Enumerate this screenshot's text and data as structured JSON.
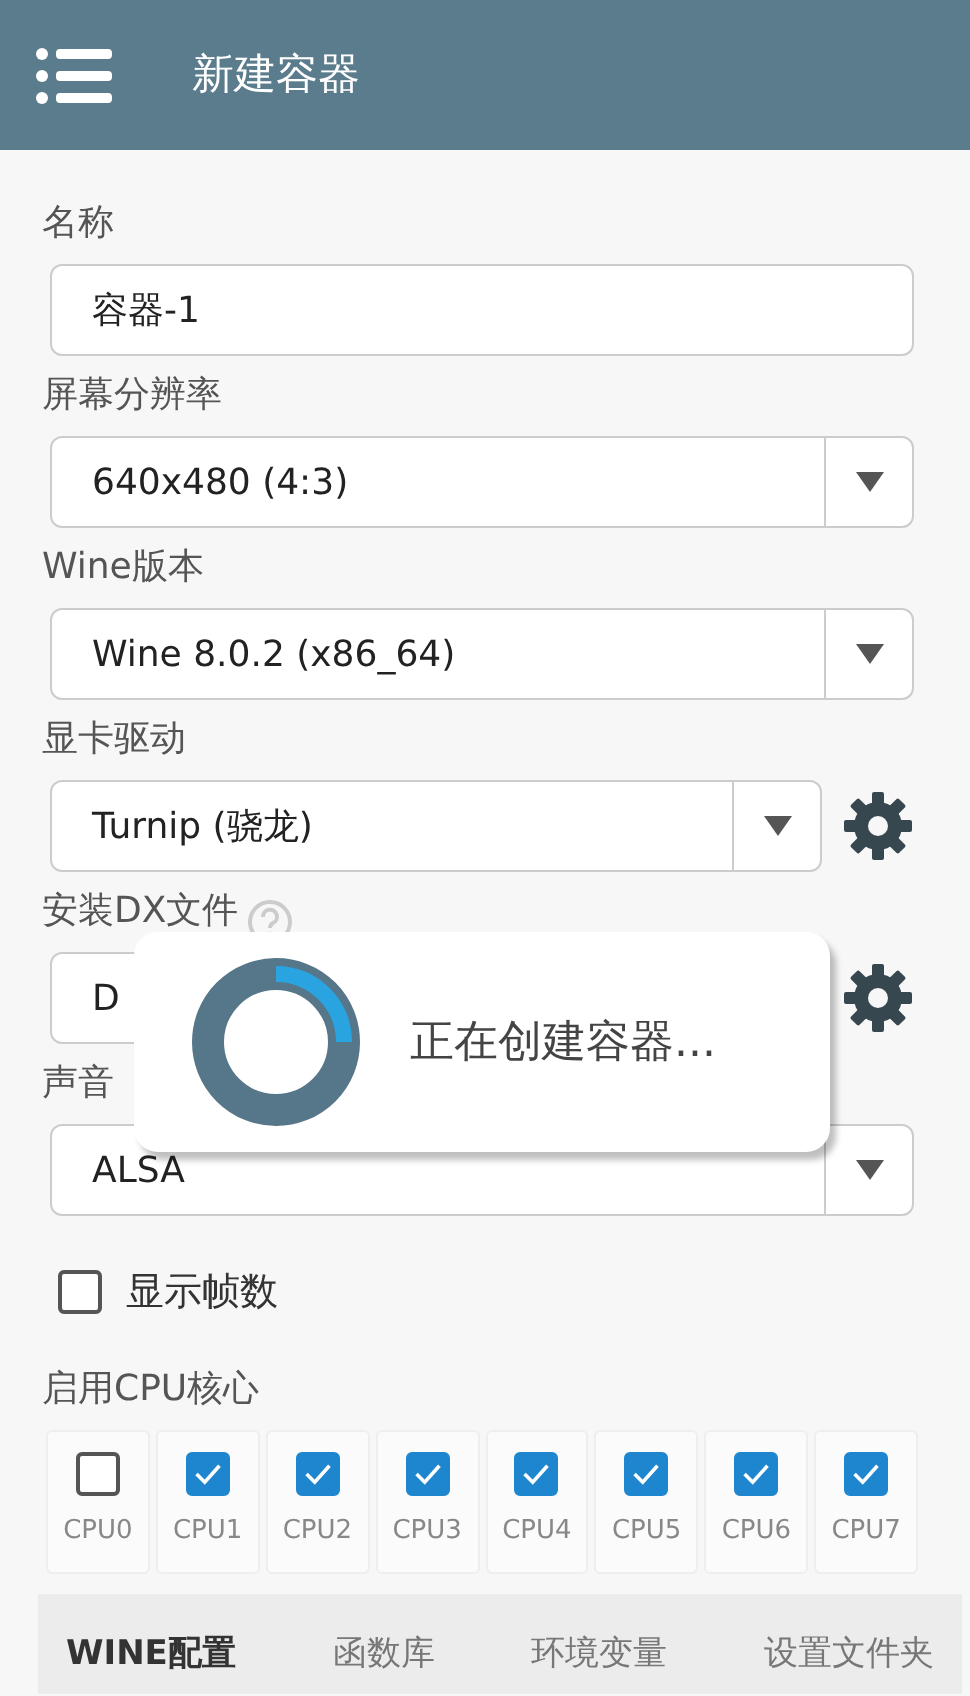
{
  "app_bar": {
    "title": "新建容器"
  },
  "form": [
    {
      "kind": "text",
      "label": "名称",
      "value": "容器-1"
    },
    {
      "kind": "select",
      "label": "屏幕分辨率",
      "value": "640x480 (4:3)"
    },
    {
      "kind": "select",
      "label": "Wine版本",
      "value": "Wine 8.0.2 (x86_64)"
    },
    {
      "kind": "select",
      "label": "显卡驱动",
      "value": "Turnip (骁龙)",
      "settings": true
    },
    {
      "kind": "select_covered",
      "label": "安装DX文件",
      "help": true,
      "value": "D",
      "settings": true
    },
    {
      "kind": "select",
      "label": "声音",
      "value": "ALSA"
    }
  ],
  "show_fps": {
    "label": "显示帧数",
    "checked": false
  },
  "cpu": {
    "label": "启用CPU核心",
    "cores": [
      {
        "label": "CPU0",
        "checked": false
      },
      {
        "label": "CPU1",
        "checked": true
      },
      {
        "label": "CPU2",
        "checked": true
      },
      {
        "label": "CPU3",
        "checked": true
      },
      {
        "label": "CPU4",
        "checked": true
      },
      {
        "label": "CPU5",
        "checked": true
      },
      {
        "label": "CPU6",
        "checked": true
      },
      {
        "label": "CPU7",
        "checked": true
      }
    ]
  },
  "tabs": [
    {
      "label": "WINE配置",
      "selected": true
    },
    {
      "label": "函数库",
      "selected": false
    },
    {
      "label": "环境变量",
      "selected": false
    },
    {
      "label": "设置文件夹",
      "selected": false
    }
  ],
  "dialog": {
    "message": "正在创建容器..."
  }
}
